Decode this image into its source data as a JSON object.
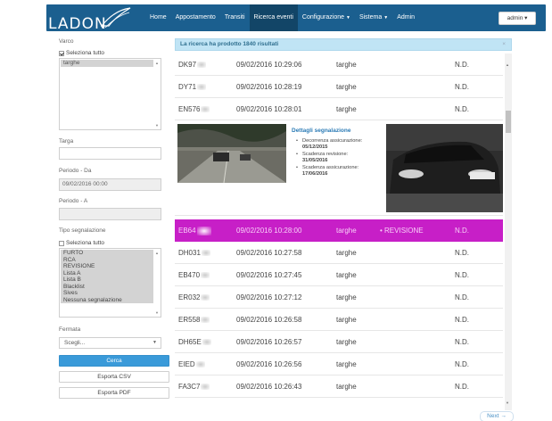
{
  "navbar": {
    "brand": "LADON",
    "links": [
      {
        "label": "Home",
        "caret": false,
        "active": false
      },
      {
        "label": "Appostamento",
        "caret": false,
        "active": false
      },
      {
        "label": "Transiti",
        "caret": false,
        "active": false
      },
      {
        "label": "Ricerca eventi",
        "caret": false,
        "active": true
      },
      {
        "label": "Configurazione",
        "caret": true,
        "active": false
      },
      {
        "label": "Sistema",
        "caret": true,
        "active": false
      },
      {
        "label": "Admin",
        "caret": false,
        "active": false
      }
    ],
    "user_button": "admin ▾",
    "colors": {
      "bar": "#1b5f8f",
      "active": "#124567"
    }
  },
  "sidebar": {
    "varco_label": "Varco",
    "varco_select_all": "Seleziona tutto",
    "varco_options": [
      "targhe"
    ],
    "targa_label": "Targa",
    "targa_value": "",
    "periodo_da_label": "Periodo - Da",
    "periodo_da_value": "09/02/2016 00:00",
    "periodo_a_label": "Periodo - A",
    "periodo_a_value": "",
    "tipo_label": "Tipo segnalazione",
    "tipo_select_all": "Seleziona tutto",
    "tipo_options": [
      "FURTO",
      "RCA",
      "REVISIONE",
      "Lista A",
      "Lista B",
      "Blacklist",
      "Sives",
      "Nessuna segnalazione"
    ],
    "fermata_label": "Fermata",
    "fermata_value": "Scegli...",
    "cerca_button": "Cerca",
    "csv_button": "Esporta CSV",
    "pdf_button": "Esporta PDF"
  },
  "alert": {
    "text": "La ricerca ha prodotto 1840 risultati",
    "close": "×"
  },
  "rows_top": [
    {
      "plate": "DK97",
      "date": "09/02/2016 10:29:06",
      "list": "targhe",
      "sig": "",
      "stato": "N.D."
    },
    {
      "plate": "DY71",
      "date": "09/02/2016 10:28:19",
      "list": "targhe",
      "sig": "",
      "stato": "N.D."
    },
    {
      "plate": "EN576",
      "date": "09/02/2016 10:28:01",
      "list": "targhe",
      "sig": "",
      "stato": "N.D."
    }
  ],
  "detail": {
    "title": "Dettagli segnalazione",
    "items": [
      {
        "label": "Decorrenza assicurazione:",
        "value": "05/12/2015"
      },
      {
        "label": "Scadenza revisione:",
        "value": "31/05/2016"
      },
      {
        "label": "Scadenza assicurazione:",
        "value": "17/06/2016"
      }
    ]
  },
  "row_highlight": {
    "plate": "EB64",
    "date": "09/02/2016 10:28:00",
    "list": "targhe",
    "sig": "• REVISIONE",
    "stato": "N.D.",
    "color": "#c71fc7"
  },
  "rows_bottom": [
    {
      "plate": "DH031",
      "date": "09/02/2016 10:27:58",
      "list": "targhe",
      "sig": "",
      "stato": "N.D."
    },
    {
      "plate": "EB470",
      "date": "09/02/2016 10:27:45",
      "list": "targhe",
      "sig": "",
      "stato": "N.D."
    },
    {
      "plate": "ER032",
      "date": "09/02/2016 10:27:12",
      "list": "targhe",
      "sig": "",
      "stato": "N.D."
    },
    {
      "plate": "ER558",
      "date": "09/02/2016 10:26:58",
      "list": "targhe",
      "sig": "",
      "stato": "N.D."
    },
    {
      "plate": "DH65E",
      "date": "09/02/2016 10:26:57",
      "list": "targhe",
      "sig": "",
      "stato": "N.D."
    },
    {
      "plate": "EIED",
      "date": "09/02/2016 10:26:56",
      "list": "targhe",
      "sig": "",
      "stato": "N.D."
    },
    {
      "plate": "FA3C7",
      "date": "09/02/2016 10:26:43",
      "list": "targhe",
      "sig": "",
      "stato": "N.D."
    }
  ],
  "pager": {
    "next": "Next →"
  }
}
